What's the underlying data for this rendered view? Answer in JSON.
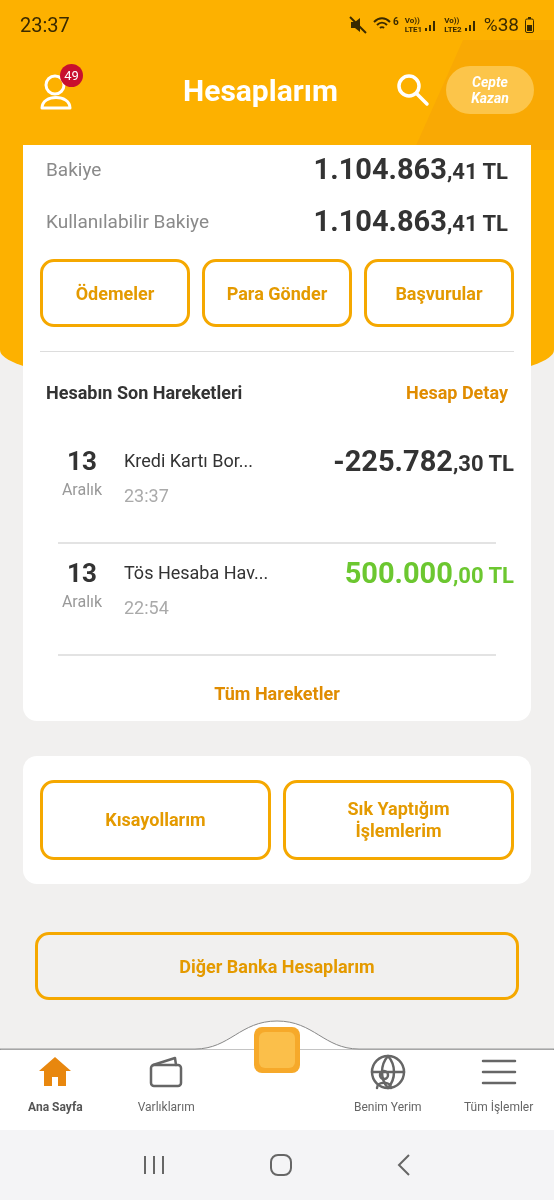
{
  "status_bar": {
    "time": "23:37",
    "wifi_label": "6",
    "lines": [
      {
        "top": "Vo))",
        "bottom": "LTE1"
      },
      {
        "top": "Vo))",
        "bottom": "LTE2"
      }
    ],
    "battery": "%38"
  },
  "header": {
    "title": "Hesaplarım",
    "notifications": "49",
    "promo": {
      "line1": "Cepte",
      "line2": "Kazan"
    }
  },
  "balances": [
    {
      "label": "Bakiye",
      "main": "1.104.863",
      "decimals": ",41 TL"
    },
    {
      "label": "Kullanılabilir Bakiye",
      "main": "1.104.863",
      "decimals": ",41 TL"
    }
  ],
  "actions": [
    "Ödemeler",
    "Para Gönder",
    "Başvurular"
  ],
  "transactions_section": {
    "title": "Hesabın Son Hareketleri",
    "link": "Hesap Detay",
    "all_link": "Tüm Hareketler",
    "items": [
      {
        "day": "13",
        "month": "Aralık",
        "description": "Kredi Kartı Bor...",
        "time": "23:37",
        "main": "-225.782",
        "decimals": ",30 TL",
        "kind": "debit"
      },
      {
        "day": "13",
        "month": "Aralık",
        "description": "Tös Hesaba Hav...",
        "time": "22:54",
        "main": "500.000",
        "decimals": ",00 TL",
        "kind": "credit"
      }
    ]
  },
  "shortcuts": [
    {
      "line1": "Kısayollarım"
    },
    {
      "line1": "Sık Yaptığım",
      "line2": "İşlemlerim"
    }
  ],
  "other_banks": "Diğer Banka Hesaplarım",
  "bottom_nav": [
    {
      "label": "Ana Sayfa",
      "kind": "home",
      "selected": true
    },
    {
      "label": "Varlıklarım",
      "kind": "wallet",
      "selected": false
    },
    {
      "kind": "cube",
      "selected": false
    },
    {
      "label": "Benim Yerim",
      "kind": "globe",
      "selected": false
    },
    {
      "label": "Tüm İşlemler",
      "kind": "menu",
      "selected": false
    }
  ]
}
